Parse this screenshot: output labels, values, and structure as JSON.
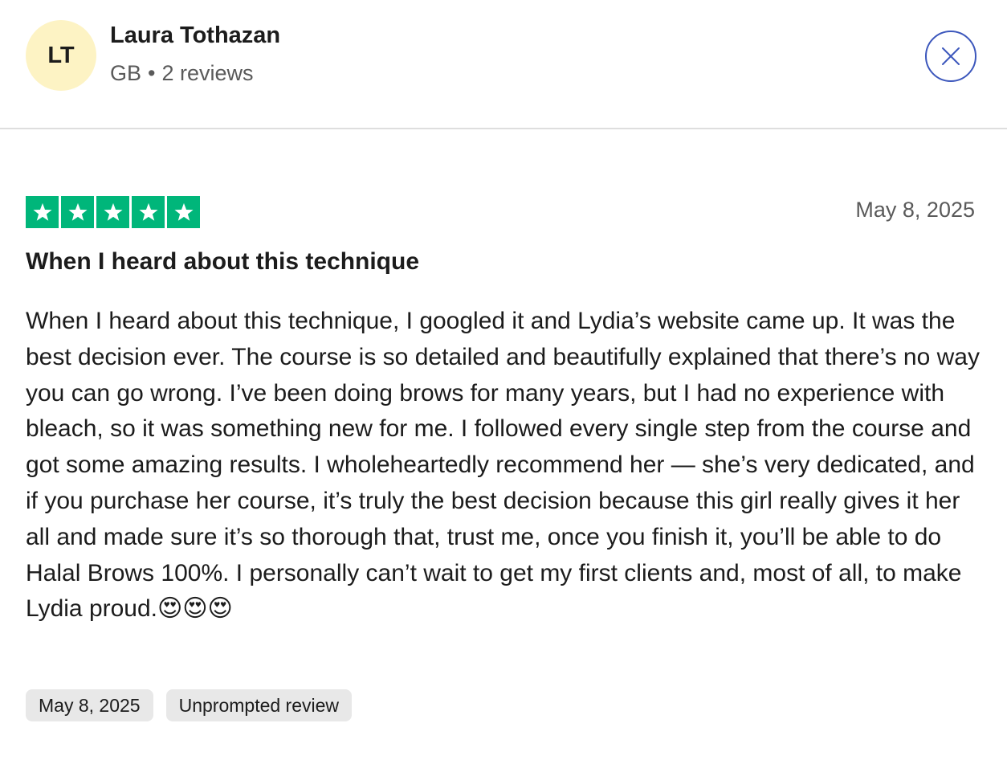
{
  "reviewer": {
    "initials": "LT",
    "name": "Laura Tothazan",
    "country": "GB",
    "separator": "•",
    "review_count": "2 reviews",
    "avatar_color": "#fdf3c4"
  },
  "close_icon": "close-icon",
  "review": {
    "rating": 5,
    "max_rating": 5,
    "star_color": "#00b67a",
    "date": "May 8, 2025",
    "title": "When I heard about this technique",
    "body": "When I heard about this technique, I googled it and Lydia’s website came up. It was the best decision ever. The course is so detailed and beautifully explained that there’s no way you can go wrong. I’ve been doing brows for many years, but I had no experience with bleach, so it was something new for me. I followed every single step from the course and got some amazing results. I wholeheartedly recommend her — she’s very dedicated, and if you purchase her course, it’s truly the best decision because this girl really gives it her all and made sure it’s so thorough that, trust me, once you finish it, you’ll be able to do Halal Brows 100%. I personally can’t wait to get my first clients and, most of all, to make Lydia proud.😍😍😍"
  },
  "tags": {
    "date": "May 8, 2025",
    "type": "Unprompted review"
  }
}
